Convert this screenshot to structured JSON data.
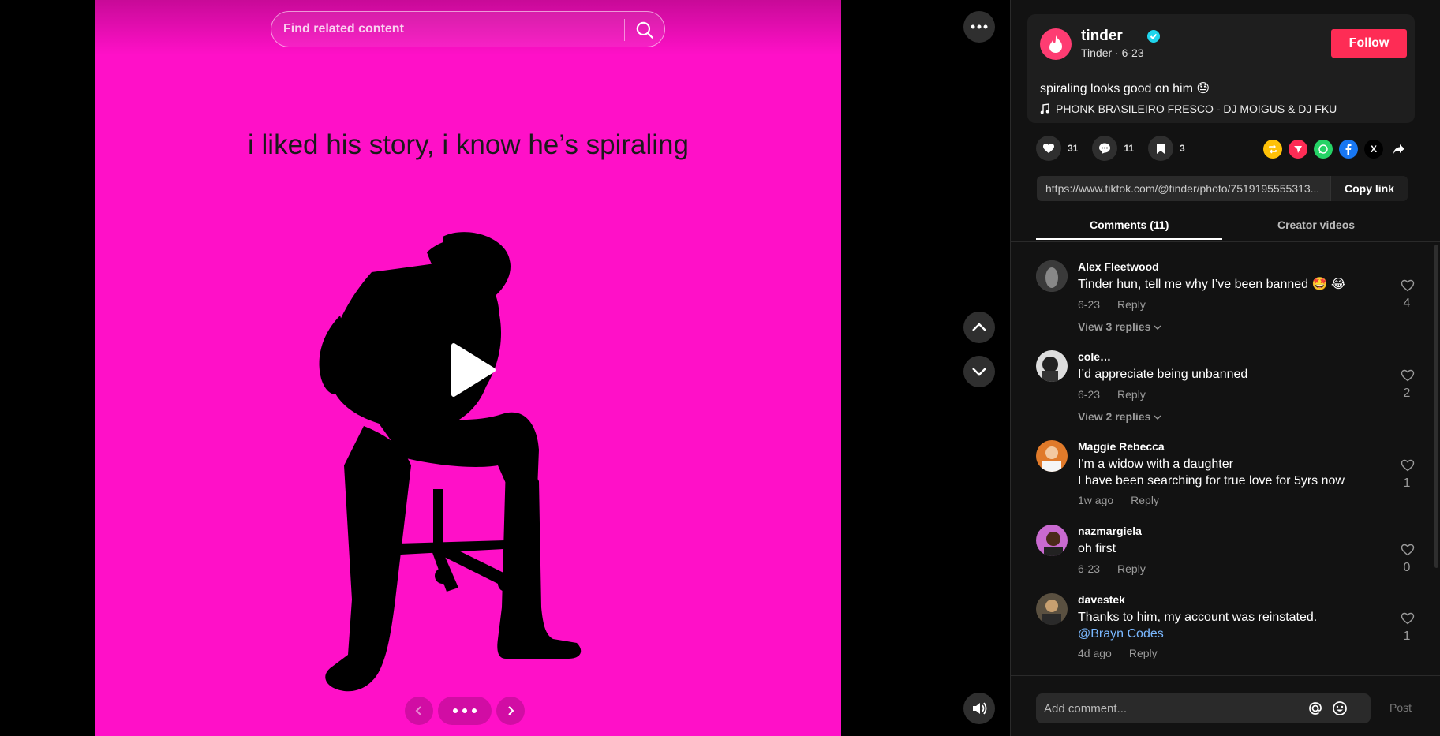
{
  "search": {
    "placeholder": "Find related content"
  },
  "photo": {
    "caption": "i liked his story, i know he’s spiraling",
    "background_color": "#ff10c8"
  },
  "author": {
    "handle": "tinder",
    "subtitle": "Tinder · 6-23",
    "follow_label": "Follow",
    "description": "spiraling looks good on him 😓",
    "music": "PHONK BRASILEIRO FRESCO - DJ MOIGUS & DJ FKU"
  },
  "stats": {
    "likes": "31",
    "comments": "11",
    "saves": "3"
  },
  "share": {
    "url": "https://www.tiktok.com/@tinder/photo/7519195555313...",
    "copy_label": "Copy link",
    "x_label": "X"
  },
  "tabs": [
    {
      "label": "Comments (11)"
    },
    {
      "label": "Creator videos"
    }
  ],
  "comments": [
    {
      "name": "Alex Fleetwood",
      "text": "Tinder hun, tell me why I’ve been banned 🤩 😂",
      "date": "6-23",
      "reply": "Reply",
      "likes": "4",
      "view": "View 3 replies"
    },
    {
      "name": "cole…",
      "text": "I’d appreciate being unbanned",
      "date": "6-23",
      "reply": "Reply",
      "likes": "2",
      "view": "View 2 replies"
    },
    {
      "name": "Maggie Rebecca",
      "text": "I'm a widow with a daughter",
      "text2": "I have been searching for true love for 5yrs now",
      "date": "1w ago",
      "reply": "Reply",
      "likes": "1"
    },
    {
      "name": "nazmargiela",
      "text": "oh first",
      "date": "6-23",
      "reply": "Reply",
      "likes": "0"
    },
    {
      "name": "davestek",
      "text": "Thanks to him, my account was reinstated.",
      "mention": "@Brayn Codes",
      "date": "4d ago",
      "reply": "Reply",
      "likes": "1"
    }
  ],
  "composer": {
    "placeholder": "Add comment...",
    "post_label": "Post"
  },
  "colors": {
    "accent": "#fe2c55",
    "brand": "#fe3c72",
    "panel": "#121212"
  }
}
